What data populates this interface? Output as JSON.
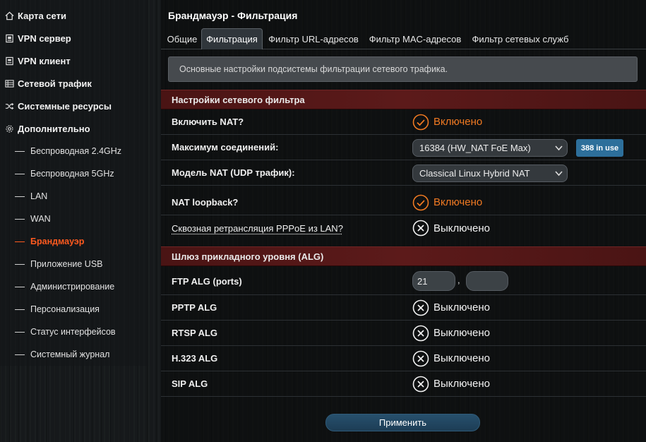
{
  "sidebar": {
    "items": [
      {
        "label": "Карта сети",
        "icon": "home-icon"
      },
      {
        "label": "VPN сервер",
        "icon": "vpn-server-icon"
      },
      {
        "label": "VPN клиент",
        "icon": "vpn-client-icon"
      },
      {
        "label": "Сетевой трафик",
        "icon": "traffic-icon"
      },
      {
        "label": "Системные ресурсы",
        "icon": "shuffle-icon"
      },
      {
        "label": "Дополнительно",
        "icon": "gear-icon"
      }
    ],
    "sub_items": [
      {
        "label": "Беспроводная 2.4GHz"
      },
      {
        "label": "Беспроводная 5GHz"
      },
      {
        "label": "LAN"
      },
      {
        "label": "WAN"
      },
      {
        "label": "Брандмауэр",
        "active": true
      },
      {
        "label": "Приложение USB"
      },
      {
        "label": "Администрирование"
      },
      {
        "label": "Персонализация"
      },
      {
        "label": "Статус интерфейсов"
      },
      {
        "label": "Системный журнал"
      }
    ]
  },
  "main": {
    "title": "Брандмауэр - Фильтрация",
    "tabs": [
      {
        "label": "Общие"
      },
      {
        "label": "Фильтрация",
        "active": true
      },
      {
        "label": "Фильтр URL-адресов"
      },
      {
        "label": "Фильтр MAC-адресов"
      },
      {
        "label": "Фильтр сетевых служб"
      }
    ],
    "description": "Основные настройки подсистемы фильтрации сетевого трафика.",
    "section1": {
      "title": "Настройки сетевого фильтра",
      "rows": {
        "nat": {
          "label": "Включить NAT?",
          "state": "Включено"
        },
        "max_conn": {
          "label": "Максимум соединений:",
          "value": "16384 (HW_NAT FoE Max)",
          "badge": "388 in use"
        },
        "nat_model": {
          "label": "Модель NAT (UDP трафик):",
          "value": "Classical Linux Hybrid NAT"
        },
        "loopback": {
          "label": "NAT loopback?",
          "state": "Включено"
        },
        "pppoe": {
          "label": "Сквозная ретрансляция PPPoE из LAN?",
          "state": "Выключено"
        }
      }
    },
    "section2": {
      "title": "Шлюз прикладного уровня (ALG)",
      "rows": {
        "ftp": {
          "label": "FTP ALG (ports)",
          "port1": "21",
          "port2": "",
          "separator": ","
        },
        "pptp": {
          "label": "PPTP ALG",
          "state": "Выключено"
        },
        "rtsp": {
          "label": "RTSP ALG",
          "state": "Выключено"
        },
        "h323": {
          "label": "H.323 ALG",
          "state": "Выключено"
        },
        "sip": {
          "label": "SIP ALG",
          "state": "Выключено"
        }
      }
    },
    "apply_label": "Применить"
  },
  "colors": {
    "accent_orange": "#f07a22",
    "active_menu": "#ff5a1f",
    "section_red": "#5c1a1a",
    "badge_blue": "#2d6f9b",
    "button_blue": "#27506d"
  }
}
